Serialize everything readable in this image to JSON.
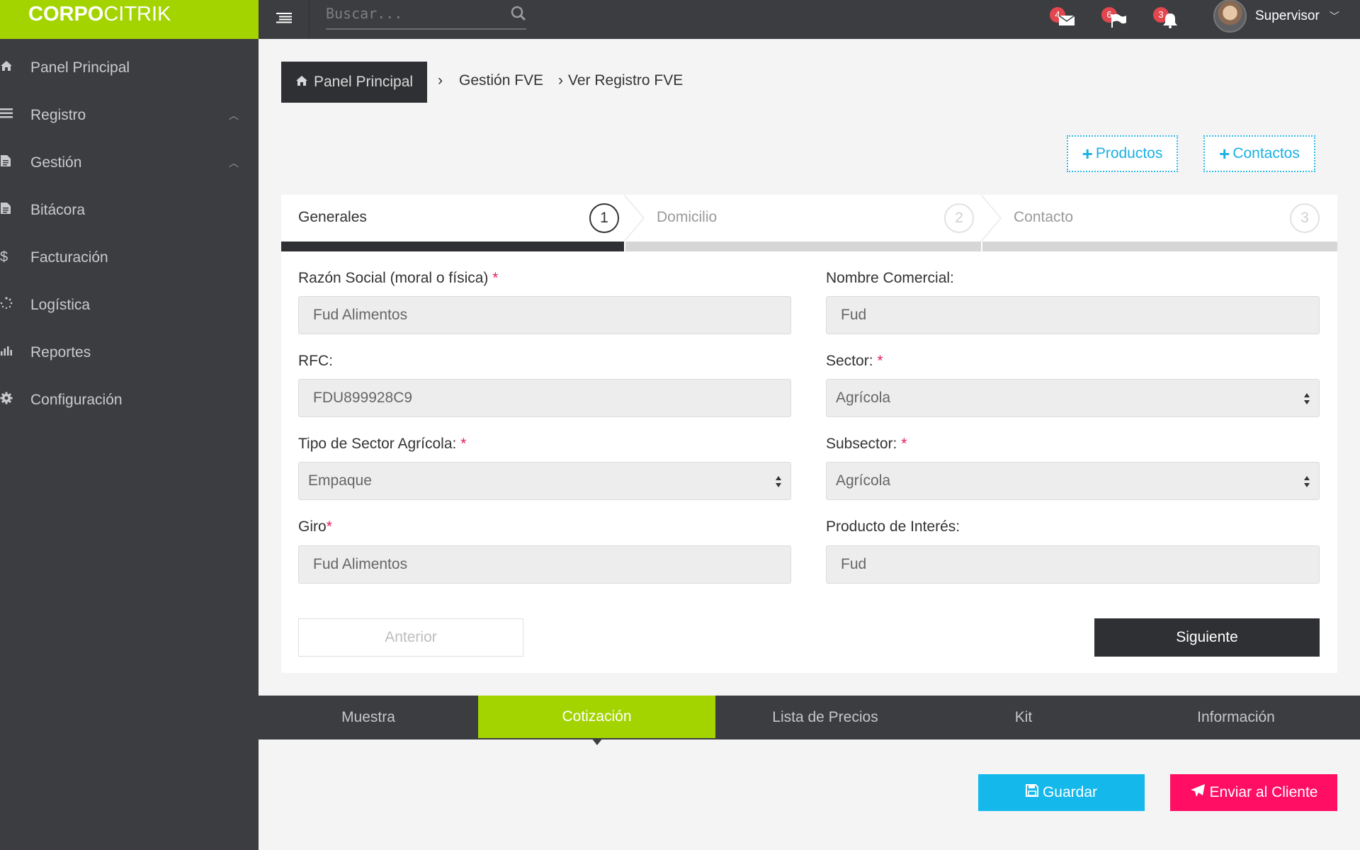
{
  "brand": {
    "part1": "CORPO",
    "part2": "CITRIK",
    "color": "#a3d400"
  },
  "sidebar": {
    "items": [
      {
        "label": "Panel Principal",
        "icon": "home-icon"
      },
      {
        "label": "Registro",
        "icon": "list-icon",
        "expandable": true
      },
      {
        "label": "Gestión",
        "icon": "document-icon",
        "expandable": true
      },
      {
        "label": "Bitácora",
        "icon": "document-icon"
      },
      {
        "label": "Facturación",
        "icon": "dollar-icon"
      },
      {
        "label": "Logística",
        "icon": "spinner-icon"
      },
      {
        "label": "Reportes",
        "icon": "bar-chart-icon"
      },
      {
        "label": "Configuración",
        "icon": "gear-icon"
      }
    ]
  },
  "topbar": {
    "search_placeholder": "Buscar...",
    "messages_count": "4",
    "flags_count": "6",
    "alerts_count": "3",
    "user_name": "Supervisor"
  },
  "breadcrumb": {
    "home": "Panel Principal",
    "level2": "Gestión FVE",
    "level3": "Ver Registro FVE"
  },
  "actions": {
    "add_products": "Productos",
    "add_contacts": "Contactos"
  },
  "wizard": {
    "steps": [
      {
        "label": "Generales",
        "number": "1",
        "state": "active"
      },
      {
        "label": "Domicilio",
        "number": "2",
        "state": "inactive"
      },
      {
        "label": "Contacto",
        "number": "3",
        "state": "inactive"
      }
    ]
  },
  "form": {
    "razon_social": {
      "label": "Razón Social (moral o física)",
      "required": "*",
      "value": "Fud Alimentos"
    },
    "nombre_comercial": {
      "label": "Nombre Comercial:",
      "value": "Fud"
    },
    "rfc": {
      "label": "RFC:",
      "value": "FDU899928C9"
    },
    "sector": {
      "label": "Sector:",
      "required": "*",
      "value": "Agrícola"
    },
    "tipo_sector": {
      "label": "Tipo de Sector Agrícola:",
      "required": "*",
      "value": "Empaque"
    },
    "subsector": {
      "label": "Subsector:",
      "required": "*",
      "value": "Agrícola"
    },
    "giro": {
      "label": "Giro",
      "required": "*",
      "value": "Fud Alimentos"
    },
    "producto_interes": {
      "label": "Producto de Interés:",
      "value": "Fud"
    },
    "prev_label": "Anterior",
    "next_label": "Siguiente"
  },
  "bottom_tabs": [
    {
      "label": "Muestra"
    },
    {
      "label": "Cotización",
      "active": true
    },
    {
      "label": "Lista de Precios"
    },
    {
      "label": "Kit"
    },
    {
      "label": "Información"
    }
  ],
  "footer_actions": {
    "save_label": "Guardar",
    "send_label": "Enviar al Cliente"
  }
}
